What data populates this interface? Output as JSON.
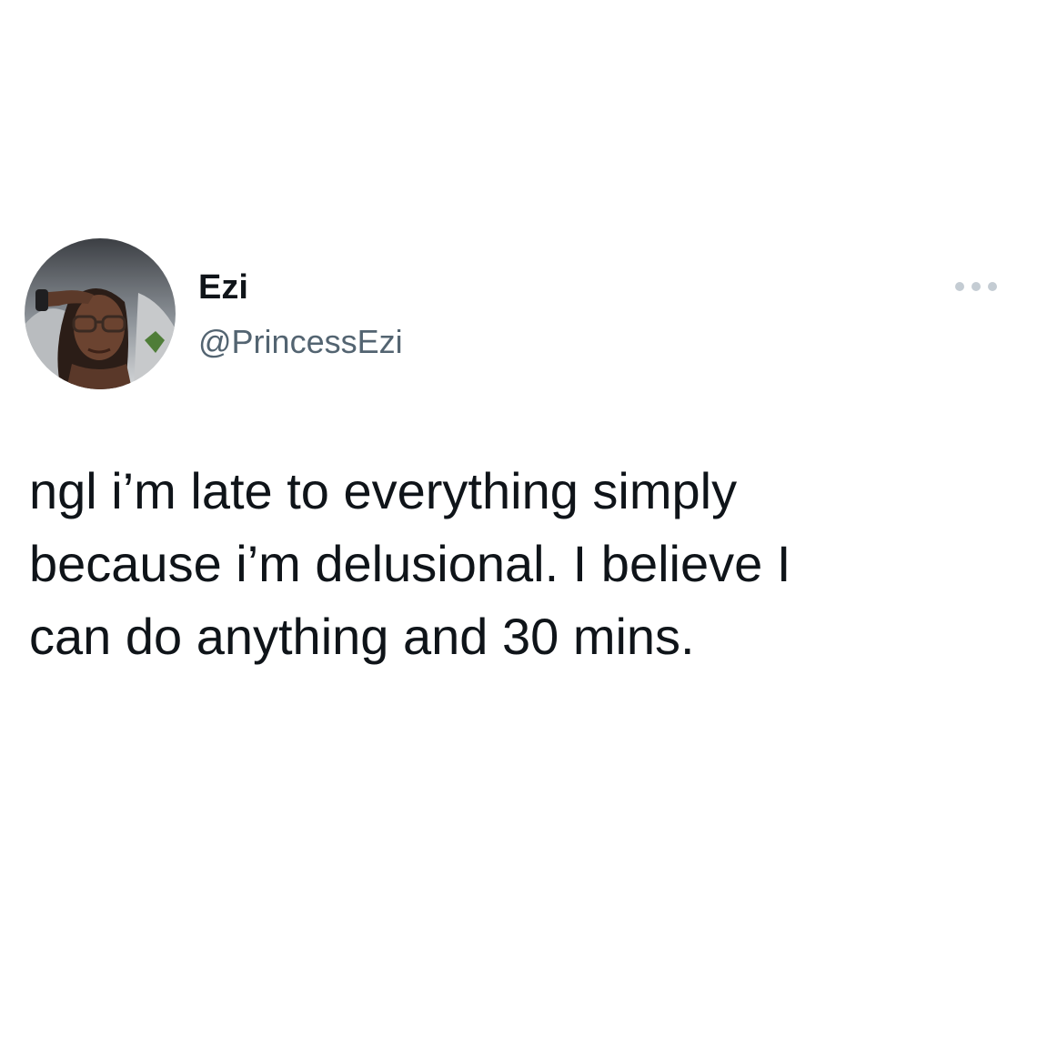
{
  "tweet": {
    "author": {
      "display_name": "Ezi",
      "handle": "@PrincessEzi",
      "avatar_icon": "profile-photo"
    },
    "more_icon": "more-horizontal-icon",
    "text_lines": [
      "ngl i’m late to everything simply",
      "because i’m delusional. I believe I",
      "can do anything and 30 mins."
    ]
  },
  "colors": {
    "background": "#ffffff",
    "primary_text": "#0f1419",
    "secondary_text": "#536471",
    "more_icon": "#c4ccd3"
  }
}
